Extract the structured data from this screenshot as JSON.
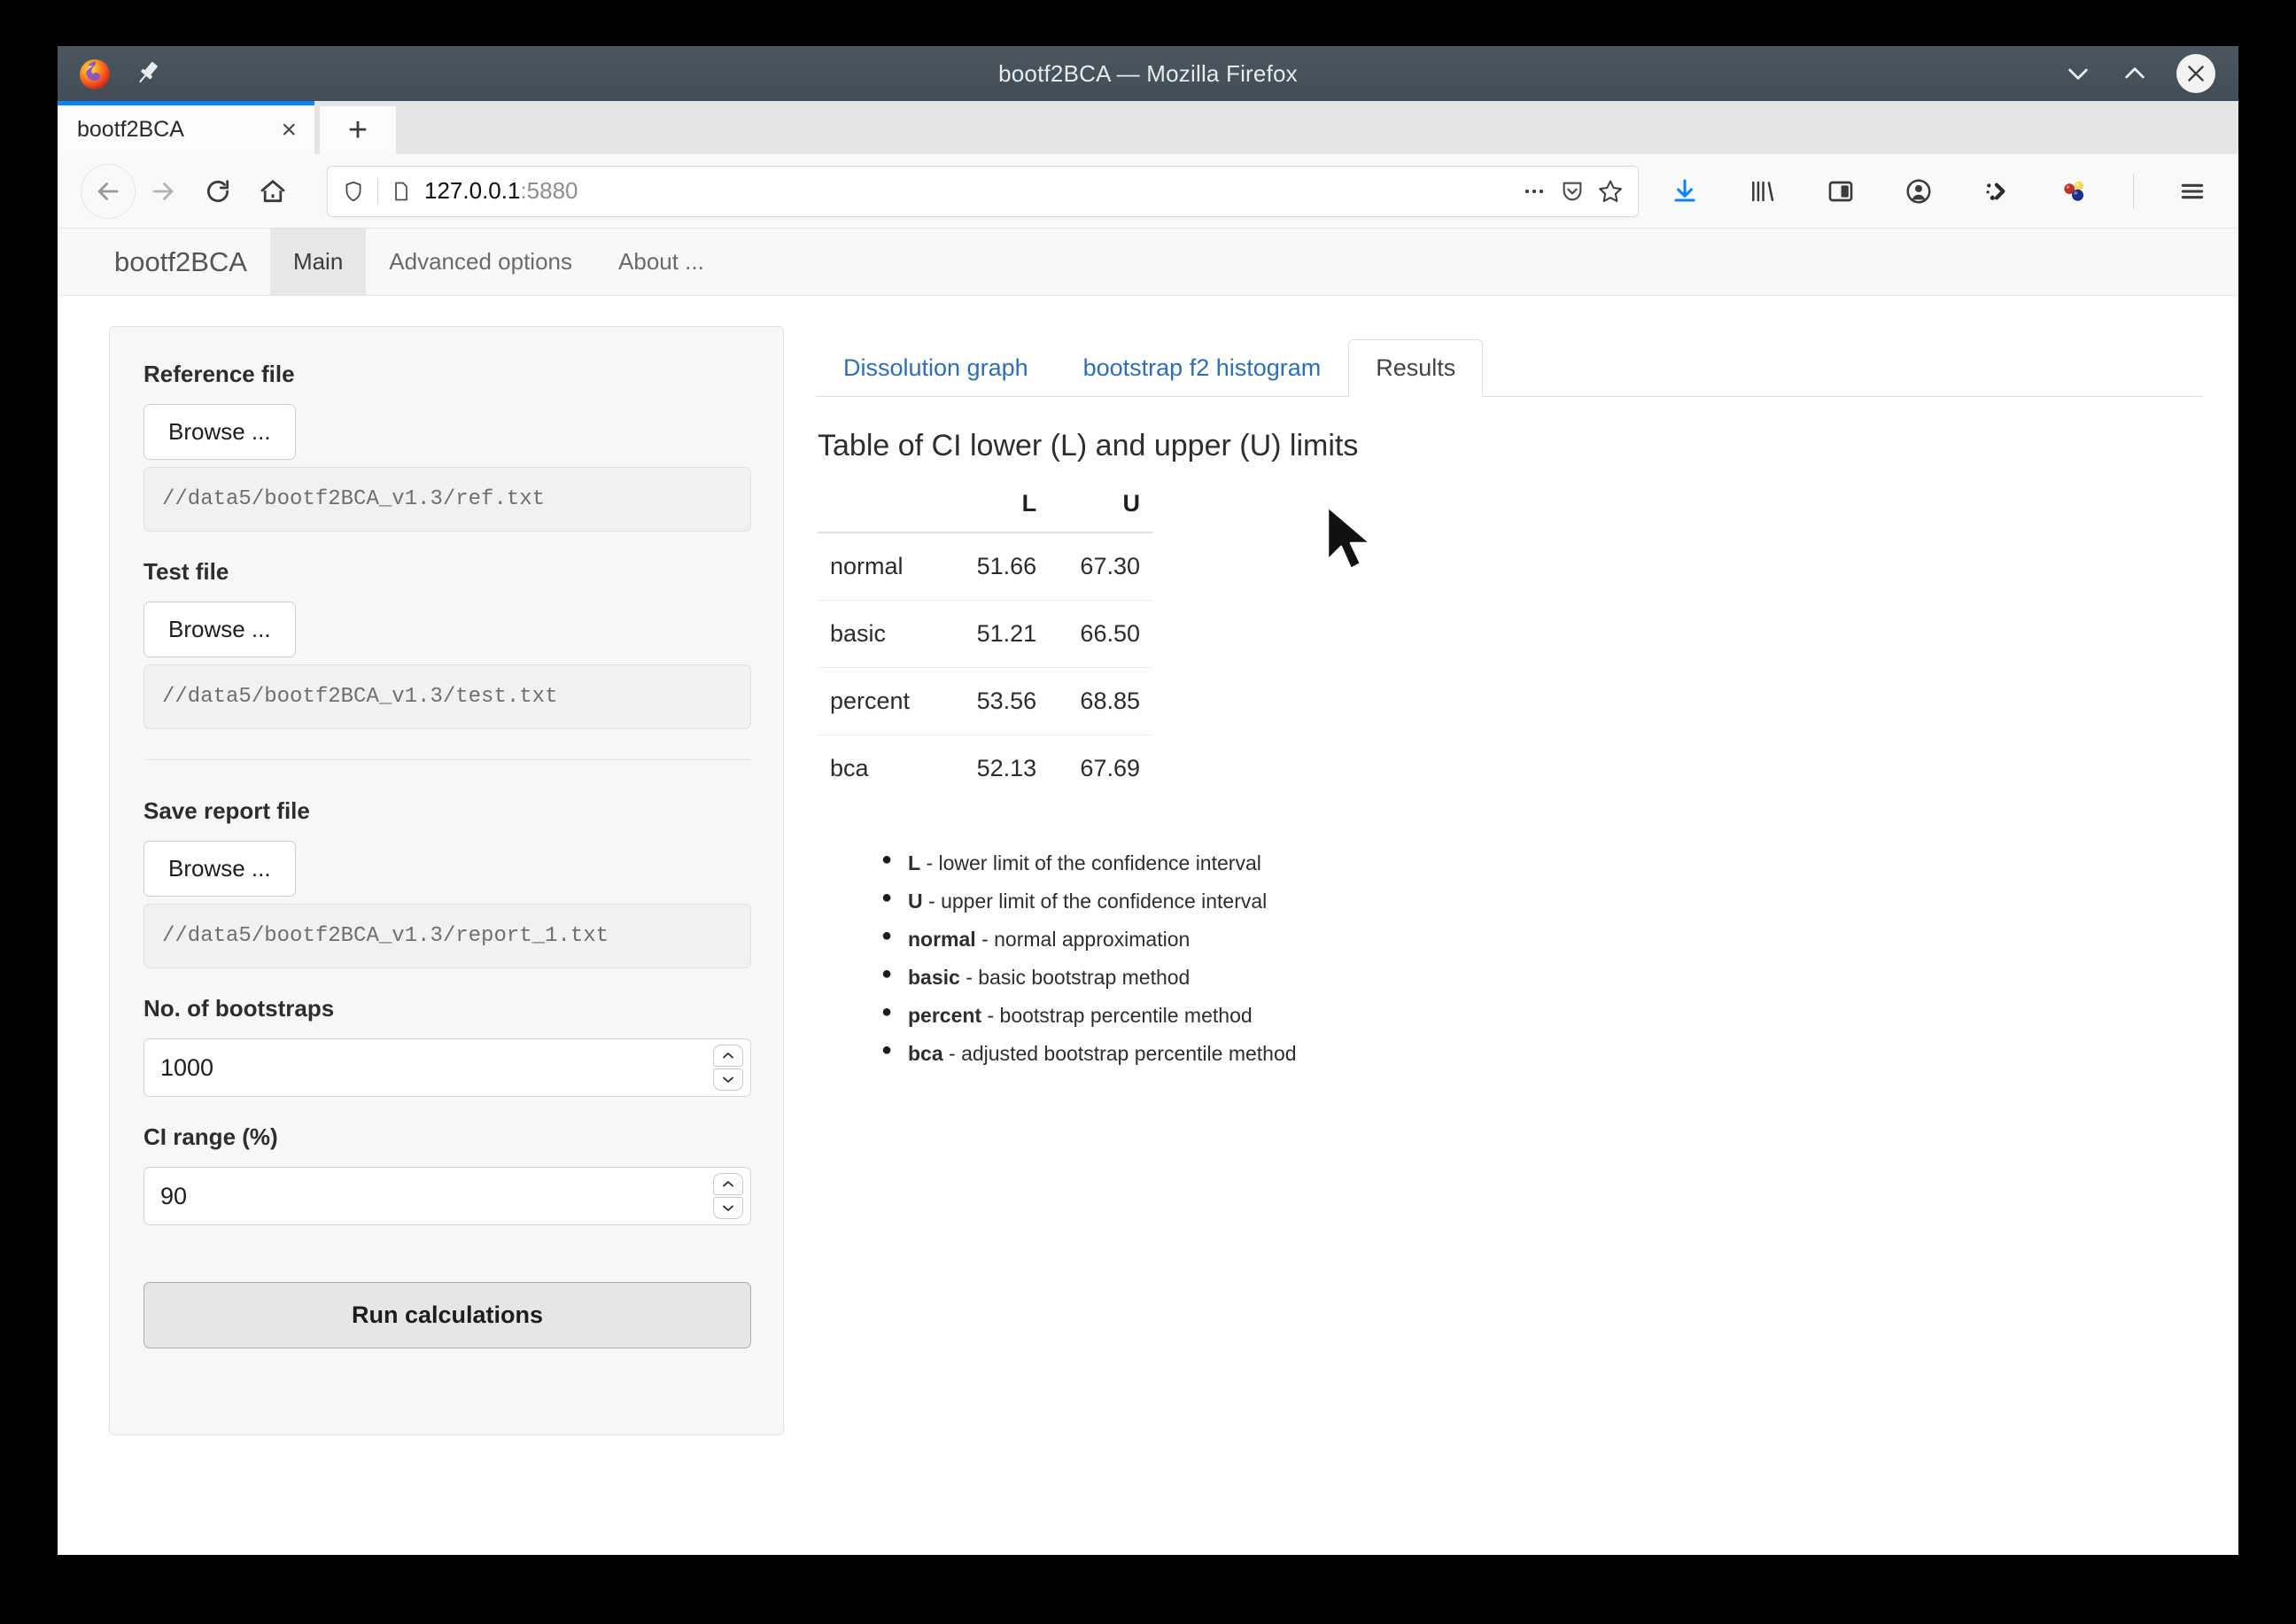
{
  "window": {
    "title": "bootf2BCA — Mozilla Firefox",
    "minimize_label": "Minimize",
    "maximize_label": "Maximize",
    "close_label": "Close"
  },
  "browser": {
    "tab": {
      "label": "bootf2BCA",
      "close_label": "×"
    },
    "new_tab_label": "+",
    "nav": {
      "back_label": "Back",
      "forward_label": "Forward",
      "reload_label": "Reload",
      "home_label": "Home"
    },
    "url": {
      "host": "127.0.0.1",
      "port": ":5880",
      "full": "127.0.0.1:5880"
    },
    "toolbar_icons": [
      "downloads-icon",
      "library-icon",
      "sidebar-icon",
      "account-icon",
      "extension-pocket-icon",
      "extension-balls-icon",
      "menu-icon"
    ]
  },
  "app": {
    "brand": "bootf2BCA",
    "nav_items": [
      {
        "label": "Main",
        "active": true
      },
      {
        "label": "Advanced options",
        "active": false
      },
      {
        "label": "About ...",
        "active": false
      }
    ]
  },
  "sidebar": {
    "reference": {
      "label": "Reference file",
      "browse_label": "Browse ...",
      "path": "//data5/bootf2BCA_v1.3/ref.txt"
    },
    "test": {
      "label": "Test file",
      "browse_label": "Browse ...",
      "path": "//data5/bootf2BCA_v1.3/test.txt"
    },
    "report": {
      "label": "Save report file",
      "browse_label": "Browse ...",
      "path": "//data5/bootf2BCA_v1.3/report_1.txt"
    },
    "bootstraps": {
      "label": "No. of bootstraps",
      "value": "1000"
    },
    "ci_range": {
      "label": "CI range (%)",
      "value": "90"
    },
    "run_button": "Run calculations"
  },
  "main": {
    "tabs": [
      {
        "label": "Dissolution graph",
        "active": false
      },
      {
        "label": "bootstrap f2 histogram",
        "active": false
      },
      {
        "label": "Results",
        "active": true
      }
    ],
    "table_title": "Table of CI lower (L) and upper (U) limits",
    "table": {
      "columns": [
        "",
        "L",
        "U"
      ],
      "rows": [
        {
          "name": "normal",
          "L": "51.66",
          "U": "67.30"
        },
        {
          "name": "basic",
          "L": "51.21",
          "U": "66.50"
        },
        {
          "name": "percent",
          "L": "53.56",
          "U": "68.85"
        },
        {
          "name": "bca",
          "L": "52.13",
          "U": "67.69"
        }
      ]
    },
    "legend": [
      {
        "term": "L",
        "desc": " - lower limit of the confidence interval"
      },
      {
        "term": "U",
        "desc": " - upper limit of the confidence interval"
      },
      {
        "term": "normal",
        "desc": " - normal approximation"
      },
      {
        "term": "basic",
        "desc": " - basic bootstrap method"
      },
      {
        "term": "percent",
        "desc": " - bootstrap percentile method"
      },
      {
        "term": "bca",
        "desc": " - adjusted bootstrap percentile method"
      }
    ]
  },
  "colors": {
    "titlebar": "#44515c",
    "tab_accent": "#0a84ff",
    "link": "#2f6eb5",
    "panel_bg": "#f7f7f7"
  }
}
